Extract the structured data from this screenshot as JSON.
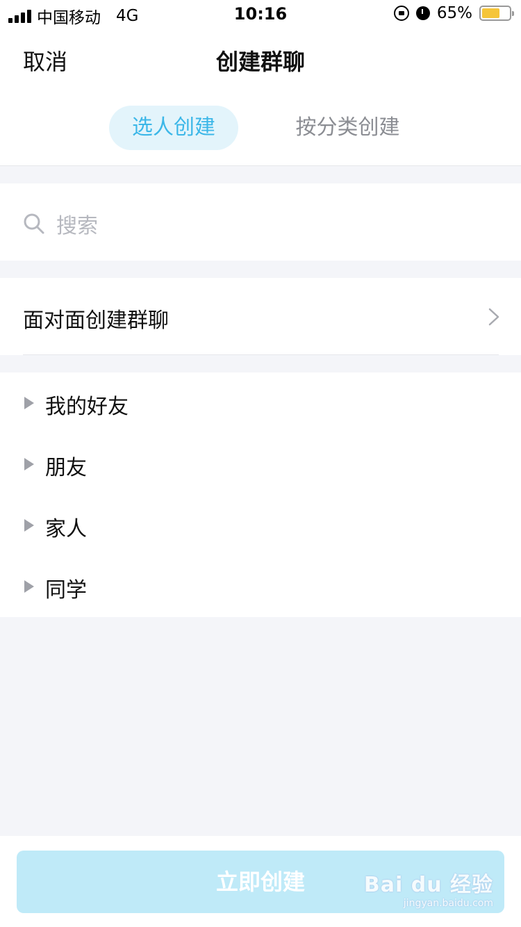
{
  "status_bar": {
    "carrier": "中国移动",
    "network": "4G",
    "time": "10:16",
    "battery_percent": "65%",
    "battery_level": 0.65,
    "battery_color": "#f5c53a"
  },
  "nav": {
    "cancel_label": "取消",
    "title": "创建群聊"
  },
  "tabs": [
    {
      "label": "选人创建",
      "active": true
    },
    {
      "label": "按分类创建",
      "active": false
    }
  ],
  "search": {
    "placeholder": "搜索",
    "icon": "search-icon"
  },
  "face_to_face": {
    "label": "面对面创建群聊",
    "icon": "chevron-right-icon"
  },
  "groups": [
    {
      "label": "我的好友"
    },
    {
      "label": "朋友"
    },
    {
      "label": "家人"
    },
    {
      "label": "同学"
    }
  ],
  "create_button": {
    "label": "立即创建",
    "enabled": false
  },
  "watermark": {
    "main": "Bai du 经验",
    "sub": "jingyan.baidu.com"
  },
  "colors": {
    "accent": "#3cb7e8",
    "accent_bg": "#e3f4fb",
    "button_disabled": "#bfeaf8",
    "page_bg": "#f4f5f9"
  }
}
